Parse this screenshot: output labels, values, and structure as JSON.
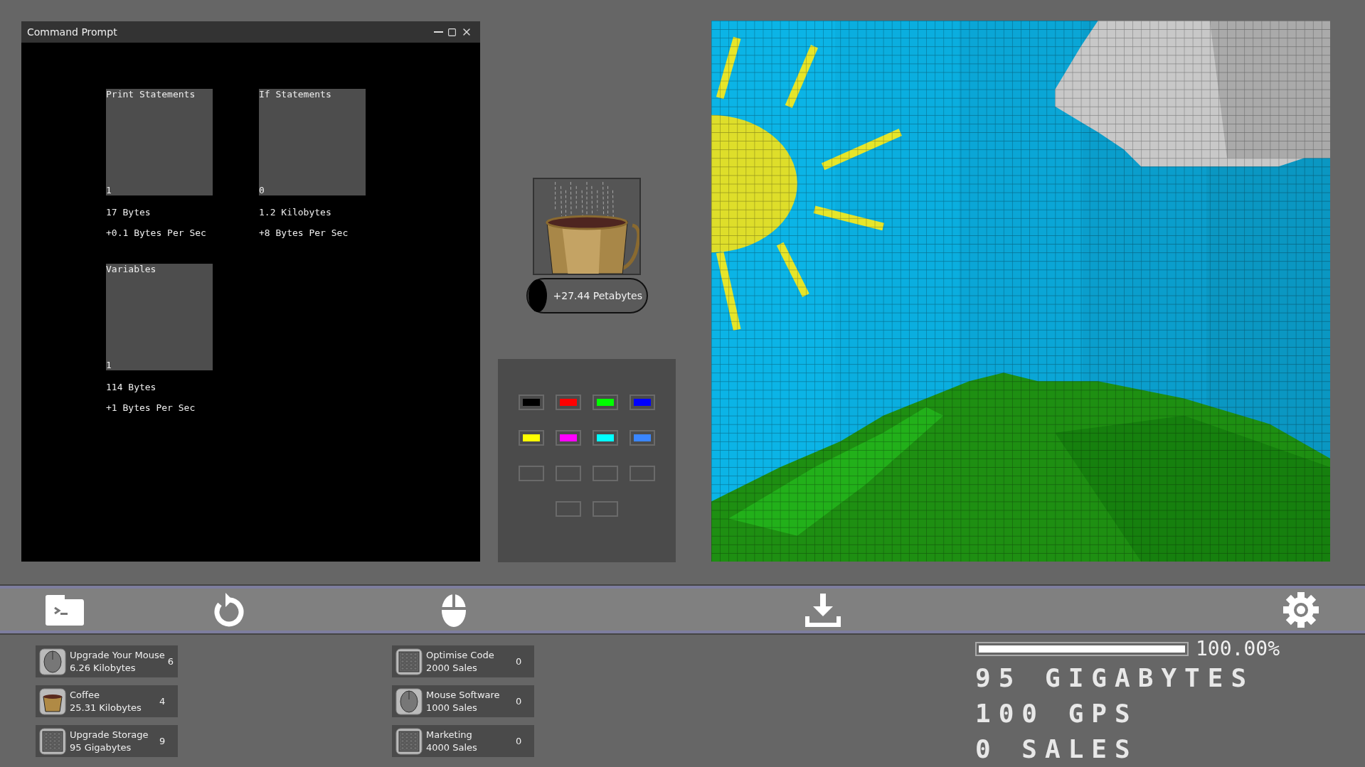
{
  "window": {
    "title": "Command Prompt"
  },
  "producers": [
    {
      "name": "Print Statements",
      "count": "1",
      "cost": "17 Bytes",
      "rate": "+0.1 Bytes Per Sec"
    },
    {
      "name": "If Statements",
      "count": "0",
      "cost": "1.2 Kilobytes",
      "rate": "+8 Bytes Per Sec"
    },
    {
      "name": "Variables",
      "count": "1",
      "cost": "114 Bytes",
      "rate": "+1 Bytes Per Sec"
    }
  ],
  "coffee": {
    "bonus": "+27.44 Petabytes"
  },
  "palette": [
    {
      "kind": "color",
      "color": "#000000"
    },
    {
      "kind": "color",
      "color": "#ff0000"
    },
    {
      "kind": "color",
      "color": "#00ff00"
    },
    {
      "kind": "color",
      "color": "#0000ff"
    },
    {
      "kind": "color",
      "color": "#ffff00"
    },
    {
      "kind": "color",
      "color": "#ff00ff"
    },
    {
      "kind": "color",
      "color": "#00ffff"
    },
    {
      "kind": "color",
      "color": "#3a86ff"
    },
    {
      "kind": "empty"
    },
    {
      "kind": "empty"
    },
    {
      "kind": "empty"
    },
    {
      "kind": "empty"
    },
    {
      "kind": "empty"
    },
    {
      "kind": "empty"
    }
  ],
  "upgrades": [
    {
      "kind": "mouse",
      "name": "Upgrade Your Mouse",
      "cost": "6.26 Kilobytes",
      "count": "6"
    },
    {
      "kind": "coffee",
      "name": "Coffee",
      "cost": "25.31 Kilobytes",
      "count": "4"
    },
    {
      "kind": "storage",
      "name": "Upgrade Storage",
      "cost": "95 Gigabytes",
      "count": "9"
    }
  ],
  "sales_upgrades": [
    {
      "kind": "storage",
      "name": "Optimise Code",
      "cost": "2000 Sales",
      "count": "0"
    },
    {
      "kind": "mouse",
      "name": "Mouse Software",
      "cost": "1000 Sales",
      "count": "0"
    },
    {
      "kind": "storage",
      "name": "Marketing",
      "cost": "4000 Sales",
      "count": "0"
    }
  ],
  "storage": {
    "level": 1,
    "percent": "100.00%"
  },
  "stats": [
    "95 GIGABYTES",
    "100 GPS",
    "0 SALES"
  ]
}
